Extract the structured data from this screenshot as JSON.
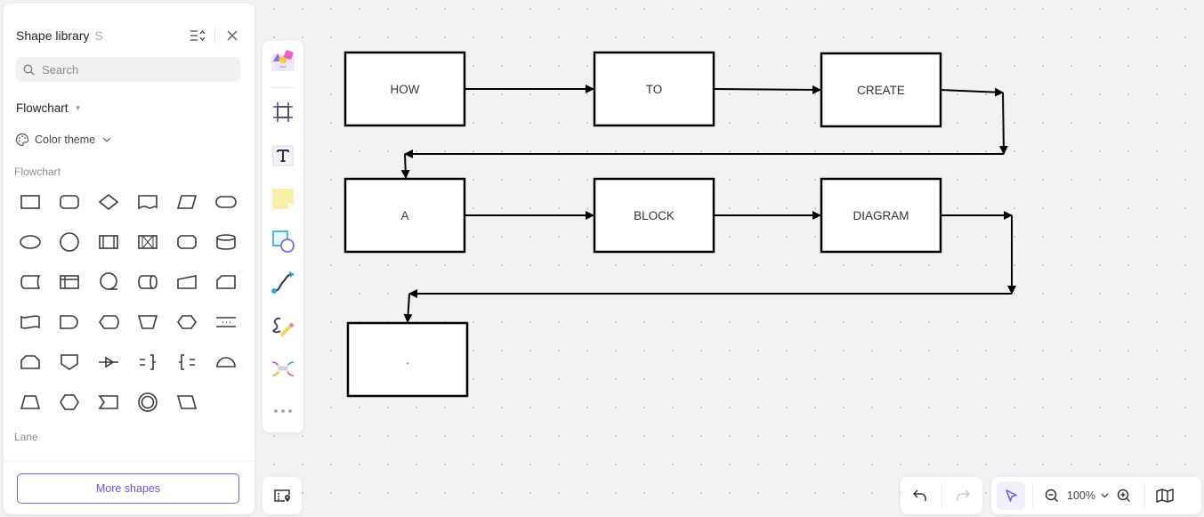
{
  "shape_library": {
    "title": "Shape library",
    "shortcut": "S",
    "search_placeholder": "Search",
    "search_value": "",
    "category": "Flowchart",
    "color_theme_label": "Color theme",
    "section_flowchart": "Flowchart",
    "section_lane": "Lane",
    "more_shapes_label": "More shapes",
    "shapes": [
      "process",
      "rounded-rectangle",
      "decision",
      "document",
      "data-io",
      "terminator",
      "ellipse",
      "circle",
      "predefined-process",
      "internal-storage-crossed",
      "alternate-process",
      "database",
      "stored-data",
      "card-storage",
      "sequential-access",
      "direct-access-storage",
      "manual-input",
      "card",
      "punched-tape",
      "delay",
      "display",
      "manual-operation",
      "preparation",
      "parallel-mode",
      "loop-limit",
      "off-page-connector",
      "merge-arrow",
      "annotation-right",
      "annotation-left",
      "half-circle",
      "trapezoid",
      "hexagon",
      "step",
      "double-circle",
      "parallelogram-alt"
    ]
  },
  "tool_rail": {
    "items": [
      "templates-icon",
      "frame-icon",
      "text-icon",
      "sticky-note-icon",
      "shape-icon",
      "connector-icon",
      "pen-icon",
      "mind-map-icon",
      "more-icon"
    ]
  },
  "diagram": {
    "nodes": [
      {
        "id": "n1",
        "label": "HOW"
      },
      {
        "id": "n2",
        "label": "TO"
      },
      {
        "id": "n3",
        "label": "CREATE"
      },
      {
        "id": "n4",
        "label": "A"
      },
      {
        "id": "n5",
        "label": "BLOCK"
      },
      {
        "id": "n6",
        "label": "DIAGRAM"
      },
      {
        "id": "n7",
        "label": "."
      }
    ],
    "edges": [
      {
        "from": "n1",
        "to": "n2"
      },
      {
        "from": "n2",
        "to": "n3"
      },
      {
        "from": "n3",
        "to": "n4"
      },
      {
        "from": "n4",
        "to": "n5"
      },
      {
        "from": "n5",
        "to": "n6"
      },
      {
        "from": "n6",
        "to": "n7"
      }
    ]
  },
  "bottom_bar": {
    "zoom_level": "100%",
    "undo_enabled": true,
    "redo_enabled": false,
    "active_tool": "select"
  },
  "colors": {
    "accent": "#6f52d1",
    "canvas_bg": "#f2f2f4",
    "node_stroke": "#000000"
  }
}
